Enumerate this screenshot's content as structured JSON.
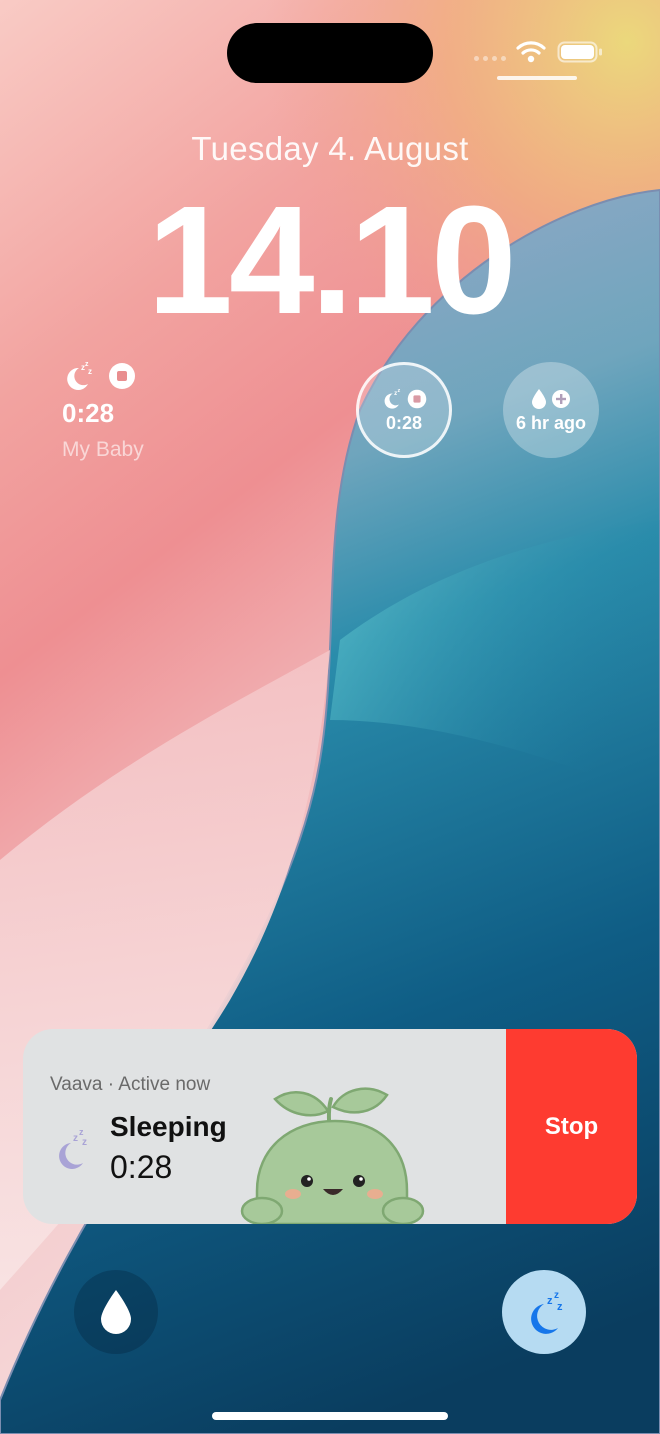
{
  "lock_screen": {
    "date": "Tuesday 4. August",
    "time": "14.10"
  },
  "status_bar": {
    "icons": [
      "cellular-signal-icon",
      "wifi-icon",
      "battery-icon"
    ]
  },
  "widgets": {
    "sleep_text_widget": {
      "icons": [
        "sleep-moon-icon",
        "stop-icon"
      ],
      "timer": "0:28",
      "baby_name": "My Baby"
    },
    "sleep_circle_widget": {
      "icons": [
        "sleep-moon-icon",
        "stop-icon"
      ],
      "timer": "0:28"
    },
    "feeding_circle_widget": {
      "icons": [
        "drop-icon",
        "plus-icon"
      ],
      "last_feed": "6 hr ago"
    }
  },
  "live_activity": {
    "app_name": "Vaava",
    "status": "Active now",
    "header": "Vaava · Active now",
    "title": "Sleeping",
    "timer": "0:28",
    "stop_label": "Stop",
    "icons": [
      "sleep-moon-icon",
      "sprout-mascot"
    ],
    "colors": {
      "stop": "#fe3b30",
      "card": "#e0e2e3",
      "moon": "#a9a3d6"
    }
  },
  "quick_actions": {
    "left_icon": "drop-icon",
    "right_icon": "sleep-moon-icon",
    "colors": {
      "right_bg": "#b6dbf2",
      "right_moon": "#1676ea"
    }
  }
}
